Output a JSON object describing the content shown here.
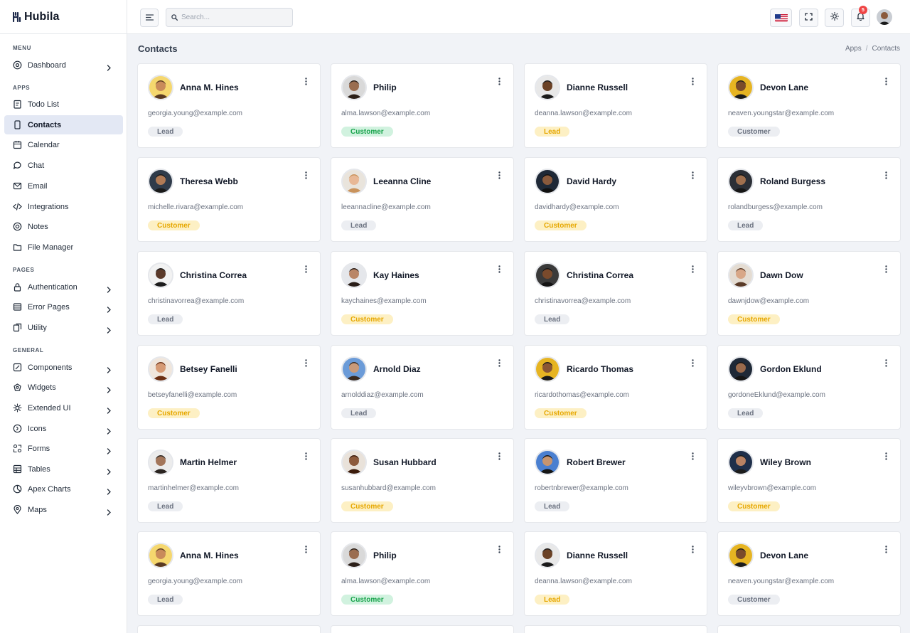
{
  "brand": {
    "name": "Hubila"
  },
  "sidebar": {
    "sections": {
      "menu": "MENU",
      "apps": "APPS",
      "pages": "PAGES",
      "general": "GENERAL"
    },
    "items": [
      {
        "label": "Dashboard",
        "icon": "dashboard-icon",
        "chevron": true,
        "active": false
      },
      {
        "label": "Todo List",
        "icon": "todo-icon",
        "chevron": false,
        "active": false
      },
      {
        "label": "Contacts",
        "icon": "contacts-icon",
        "chevron": false,
        "active": true
      },
      {
        "label": "Calendar",
        "icon": "calendar-icon",
        "chevron": false,
        "active": false
      },
      {
        "label": "Chat",
        "icon": "chat-icon",
        "chevron": false,
        "active": false
      },
      {
        "label": "Email",
        "icon": "email-icon",
        "chevron": false,
        "active": false
      },
      {
        "label": "Integrations",
        "icon": "code-icon",
        "chevron": false,
        "active": false
      },
      {
        "label": "Notes",
        "icon": "notes-icon",
        "chevron": false,
        "active": false
      },
      {
        "label": "File Manager",
        "icon": "folder-icon",
        "chevron": false,
        "active": false
      },
      {
        "label": "Authentication",
        "icon": "lock-icon",
        "chevron": true,
        "active": false
      },
      {
        "label": "Error Pages",
        "icon": "error-icon",
        "chevron": true,
        "active": false
      },
      {
        "label": "Utility",
        "icon": "utility-icon",
        "chevron": true,
        "active": false
      },
      {
        "label": "Components",
        "icon": "components-icon",
        "chevron": true,
        "active": false
      },
      {
        "label": "Widgets",
        "icon": "widgets-icon",
        "chevron": true,
        "active": false
      },
      {
        "label": "Extended UI",
        "icon": "extended-icon",
        "chevron": true,
        "active": false
      },
      {
        "label": "Icons",
        "icon": "icons-icon",
        "chevron": true,
        "active": false
      },
      {
        "label": "Forms",
        "icon": "forms-icon",
        "chevron": true,
        "active": false
      },
      {
        "label": "Tables",
        "icon": "table-icon",
        "chevron": true,
        "active": false
      },
      {
        "label": "Apex Charts",
        "icon": "chart-icon",
        "chevron": true,
        "active": false
      },
      {
        "label": "Maps",
        "icon": "map-pin-icon",
        "chevron": true,
        "active": false
      }
    ]
  },
  "topbar": {
    "search_placeholder": "Search...",
    "notification_count": "5",
    "language": "flag-us-icon"
  },
  "page": {
    "title": "Contacts",
    "breadcrumb": {
      "parent": "Apps",
      "separator": "/",
      "current": "Contacts"
    }
  },
  "colors": {
    "accent_active_bg": "#e3e8f4",
    "lead_bg": "#eceef2",
    "customer_green_bg": "#d1f2df",
    "customer_green_text": "#16a34a",
    "customer_yellow_bg": "#fdf0c4",
    "customer_yellow_text": "#e6a700",
    "badge_red": "#ef4444"
  },
  "contacts": [
    {
      "name": "Anna M. Hines",
      "email": "georgia.young@example.com",
      "tag": "Lead",
      "style": "lead"
    },
    {
      "name": "Philip",
      "email": "alma.lawson@example.com",
      "tag": "Customer",
      "style": "customer-green"
    },
    {
      "name": "Dianne Russell",
      "email": "deanna.lawson@example.com",
      "tag": "Lead",
      "style": "customer-yellow"
    },
    {
      "name": "Devon Lane",
      "email": "neaven.youngstar@example.com",
      "tag": "Customer",
      "style": "customer-gray"
    },
    {
      "name": "Theresa Webb",
      "email": "michelle.rivara@example.com",
      "tag": "Customer",
      "style": "customer-yellow"
    },
    {
      "name": "Leeanna Cline",
      "email": "leeannacline@example.com",
      "tag": "Lead",
      "style": "lead"
    },
    {
      "name": "David Hardy",
      "email": "davidhardy@example.com",
      "tag": "Customer",
      "style": "customer-yellow"
    },
    {
      "name": "Roland Burgess",
      "email": "rolandburgess@example.com",
      "tag": "Lead",
      "style": "lead"
    },
    {
      "name": "Christina Correa",
      "email": "christinavorrea@example.com",
      "tag": "Lead",
      "style": "lead"
    },
    {
      "name": "Kay Haines",
      "email": "kaychaines@example.com",
      "tag": "Customer",
      "style": "customer-yellow"
    },
    {
      "name": "Christina Correa",
      "email": "christinavorrea@example.com",
      "tag": "Lead",
      "style": "lead"
    },
    {
      "name": "Dawn Dow",
      "email": "dawnjdow@example.com",
      "tag": "Customer",
      "style": "customer-yellow"
    },
    {
      "name": "Betsey Fanelli",
      "email": "betseyfanelli@example.com",
      "tag": "Customer",
      "style": "customer-yellow"
    },
    {
      "name": "Arnold Diaz",
      "email": "arnolddiaz@example.com",
      "tag": "Lead",
      "style": "lead"
    },
    {
      "name": "Ricardo Thomas",
      "email": "ricardothomas@example.com",
      "tag": "Customer",
      "style": "customer-yellow"
    },
    {
      "name": "Gordon Eklund",
      "email": "gordoneEklund@example.com",
      "tag": "Lead",
      "style": "lead"
    },
    {
      "name": "Martin Helmer",
      "email": "martinhelmer@example.com",
      "tag": "Lead",
      "style": "lead"
    },
    {
      "name": "Susan Hubbard",
      "email": "susanhubbard@example.com",
      "tag": "Customer",
      "style": "customer-yellow"
    },
    {
      "name": "Robert Brewer",
      "email": "robertnbrewer@example.com",
      "tag": "Lead",
      "style": "lead"
    },
    {
      "name": "Wiley Brown",
      "email": "wileyvbrown@example.com",
      "tag": "Customer",
      "style": "customer-yellow"
    },
    {
      "name": "Anna M. Hines",
      "email": "georgia.young@example.com",
      "tag": "Lead",
      "style": "lead"
    },
    {
      "name": "Philip",
      "email": "alma.lawson@example.com",
      "tag": "Customer",
      "style": "customer-green"
    },
    {
      "name": "Dianne Russell",
      "email": "deanna.lawson@example.com",
      "tag": "Lead",
      "style": "customer-yellow"
    },
    {
      "name": "Devon Lane",
      "email": "neaven.youngstar@example.com",
      "tag": "Customer",
      "style": "customer-gray"
    }
  ]
}
